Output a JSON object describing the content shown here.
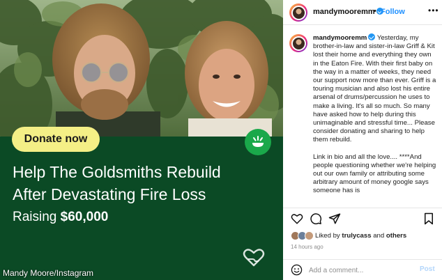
{
  "media": {
    "donate_label": "Donate now",
    "title_line1": "Help The Goldsmiths Rebuild",
    "title_line2": "After Devastating Fire Loss",
    "raising_label": "Raising",
    "raising_amount": "$60,000",
    "credit": "Mandy Moore/Instagram",
    "colors": {
      "green_panel": "#0b4a25",
      "donate_button": "#f4ef86",
      "badge": "#1aa84a"
    },
    "icons": [
      "gofundme-badge-icon",
      "heart-hand-icon"
    ]
  },
  "post": {
    "username": "mandymooremm",
    "dot": "•",
    "follow_label": "Follow",
    "caption_p1": "Yesterday, my brother-in-law and sister-in-law Griff & Kit lost their home and everything they own in the Eaton Fire. With their first baby on the way in a matter of weeks, they need our support now more than ever. Griff is a touring musician and also lost his entire arsenal of drums/percussion he uses to make a living. It's all so much. So many have asked how to help during this unimaginable and stressful time... Please consider donating and sharing to help them rebuild.",
    "caption_p2": "Link in bio and all the love.... ****And people questioning whether we're helping out our own family or attributing some arbitrary amount of money google says someone has is",
    "liked_prefix": "Liked by",
    "liked_user": "trulycass",
    "liked_and": "and",
    "liked_others": "others",
    "time": "14 hours ago",
    "comment_placeholder": "Add a comment...",
    "post_label": "Post",
    "colors": {
      "follow": "#1e90ff",
      "verified": "#2196f3",
      "post_disabled": "#b3d6fb"
    },
    "icons": [
      "more-icon",
      "heart-icon",
      "comment-icon",
      "share-icon",
      "bookmark-icon",
      "emoji-icon",
      "verified-badge-icon"
    ]
  }
}
